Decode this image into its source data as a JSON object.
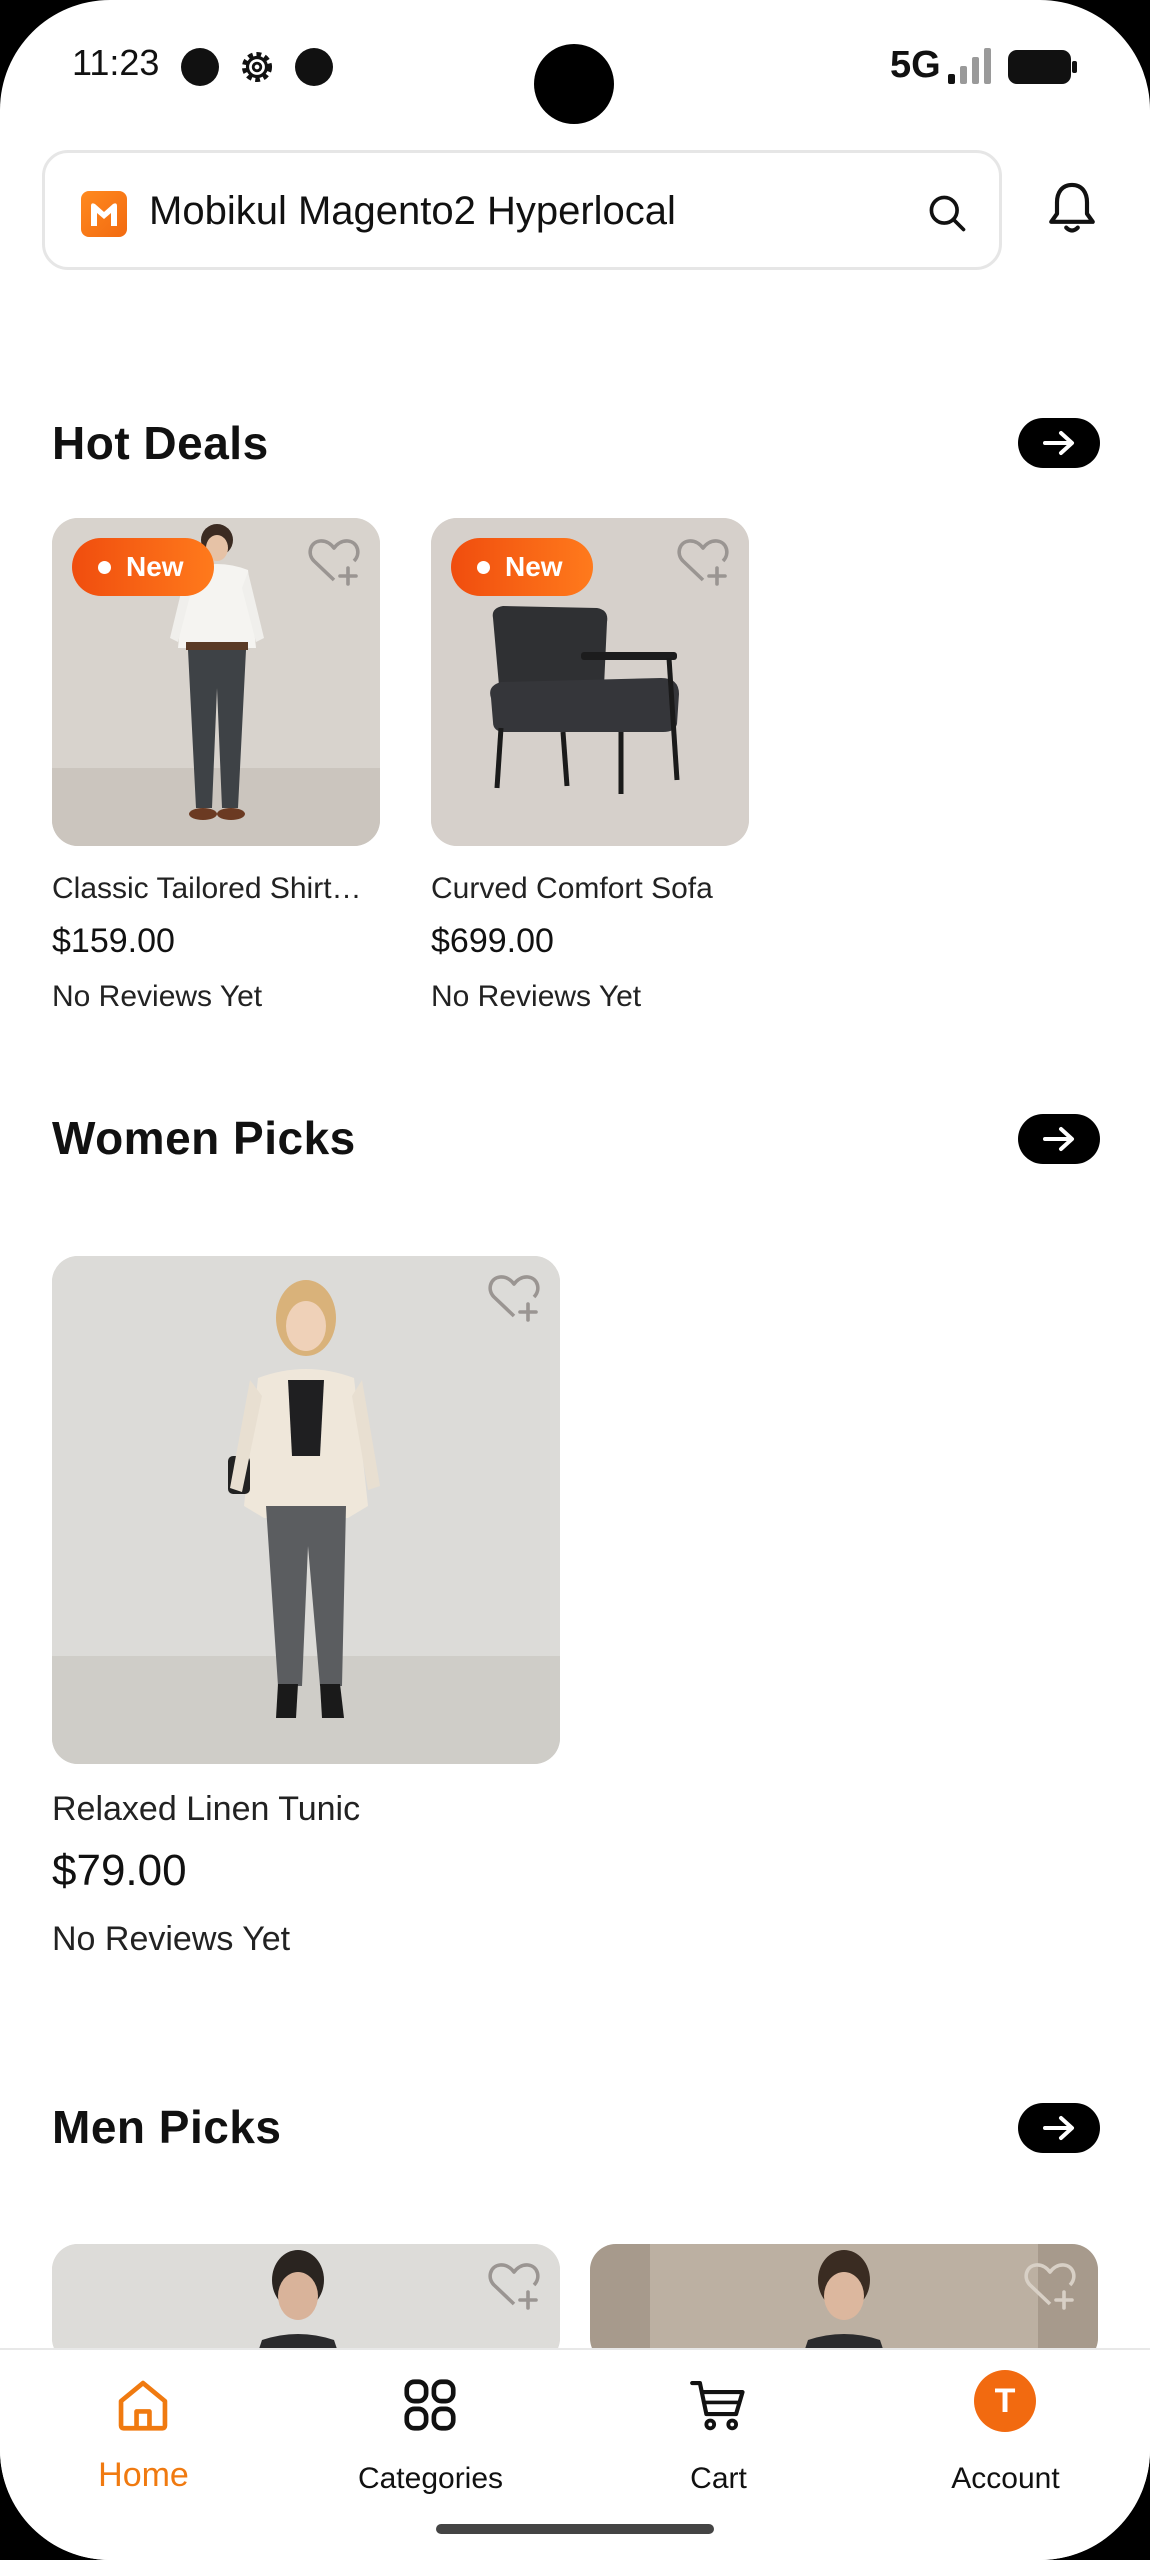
{
  "status_bar": {
    "time": "11:23",
    "network": "5G"
  },
  "header": {
    "app_name": "Mobikul Magento2 Hyperlocal",
    "logo_icon": "mobikul-logo-icon",
    "search_icon": "search-icon",
    "notification_icon": "bell-icon"
  },
  "sections": {
    "hot_deals": {
      "title": "Hot Deals",
      "products": [
        {
          "name": "Classic Tailored Shirt…",
          "price": "$159.00",
          "reviews": "No Reviews Yet",
          "badge": "New"
        },
        {
          "name": "Curved Comfort Sofa",
          "price": "$699.00",
          "reviews": "No Reviews Yet",
          "badge": "New"
        }
      ]
    },
    "women_picks": {
      "title": "Women Picks",
      "products": [
        {
          "name": "Relaxed Linen Tunic",
          "price": "$79.00",
          "reviews": "No Reviews Yet"
        }
      ]
    },
    "men_picks": {
      "title": "Men Picks"
    }
  },
  "bottom_nav": {
    "items": [
      {
        "label": "Home",
        "icon": "home-icon",
        "active": true
      },
      {
        "label": "Categories",
        "icon": "categories-icon",
        "active": false
      },
      {
        "label": "Cart",
        "icon": "cart-icon",
        "active": false
      },
      {
        "label": "Account",
        "icon": "account-avatar",
        "active": false
      }
    ],
    "account_initial": "T"
  },
  "colors": {
    "accent": "#f07a10",
    "badge_gradient_start": "#f04d0e",
    "badge_gradient_end": "#ff7a1c",
    "text": "#111111"
  }
}
